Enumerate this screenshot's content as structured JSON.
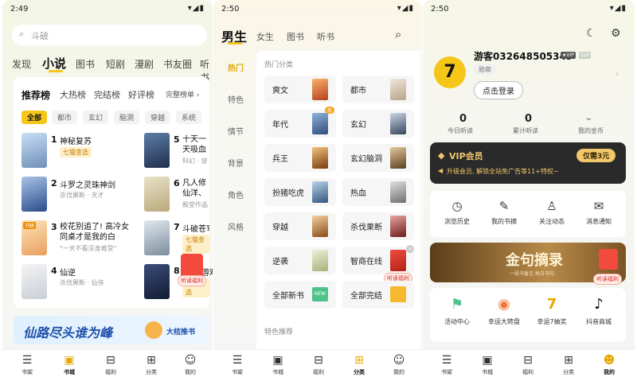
{
  "screen1": {
    "time": "2:49",
    "search_placeholder": "斗破",
    "tabs": [
      "发现",
      "小说",
      "图书",
      "短剧",
      "漫剧",
      "书友圈",
      "听书"
    ],
    "rank_tabs": [
      "推荐榜",
      "大热榜",
      "完结榜",
      "好评榜"
    ],
    "full_list": "完整榜单 ›",
    "chips": [
      "全部",
      "都市",
      "玄幻",
      "脑洞",
      "穿越",
      "系统"
    ],
    "books_left": [
      {
        "rank": "1",
        "title": "神秘复苏",
        "sub": "七猫金选",
        "tag": "badge"
      },
      {
        "rank": "2",
        "title": "斗罗之灵珠神剑",
        "sub": "杀伐果断 · 天才",
        "tag": "text"
      },
      {
        "rank": "3",
        "title": "校花别追了! 高冷女同桌才是我的白",
        "sub": "\"一天不看浑身难受\"",
        "tag": "text"
      },
      {
        "rank": "4",
        "title": "仙逆",
        "sub": "杀伐果断 · 仙侠",
        "tag": "text"
      }
    ],
    "books_right": [
      {
        "rank": "5",
        "title": "十天一天吸血鬼仙",
        "sub": "科幻 · 穿"
      },
      {
        "rank": "6",
        "title": "凡人修仙洋、金属",
        "sub": "殿堂作品"
      },
      {
        "rank": "7",
        "title": "斗破苍穹",
        "sub": "七猫金选"
      },
      {
        "rank": "8",
        "title": "游戏",
        "sub": "七猫金选"
      }
    ],
    "cover_tag": "书耕",
    "banner_text": "仙路尽头谁为峰",
    "banner_btn": "大桔推书",
    "hb_label": "听读福利",
    "nav": [
      "书架",
      "书城",
      "福利",
      "分类",
      "我的"
    ]
  },
  "screen2": {
    "time": "2:50",
    "tabs": [
      "男生",
      "女生",
      "图书",
      "听书"
    ],
    "side": [
      "热门",
      "特色",
      "情节",
      "背景",
      "角色",
      "风格"
    ],
    "section_title": "热门分类",
    "cells": [
      "爽文",
      "都市",
      "年代",
      "玄幻",
      "兵王",
      "玄幻脑洞",
      "扮猪吃虎",
      "热血",
      "穿越",
      "杀伐果断",
      "逆袭",
      "智商在线",
      "全部新书",
      "全部完结"
    ],
    "hot_badge": "热",
    "new_badge": "NEW",
    "section2": "特色推荐",
    "hb_label": "听读福利",
    "nav": [
      "书架",
      "书城",
      "福利",
      "分类",
      "我的"
    ]
  },
  "screen3": {
    "time": "2:50",
    "username": "游客032648505349",
    "vip_tag": "★VIP",
    "lv_tag": "Lv0",
    "medal": "勋章",
    "login_btn": "点击登录",
    "stats": [
      {
        "value": "0",
        "label": "今日听读"
      },
      {
        "value": "0",
        "label": "累计听读"
      },
      {
        "value": "",
        "label": "我的金币"
      }
    ],
    "vip_title": "VIP会员",
    "vip_desc": "升级会员, 解锁全站免广告等11+特权~",
    "vip_price": "仅需3元",
    "menu": [
      "浏览历史",
      "我的书摘",
      "关注动态",
      "消息通知"
    ],
    "banner_text": "金句摘录",
    "banner_sub": "一段书香言,每日书句",
    "activities": [
      "活动中心",
      "幸运大转盘",
      "幸运7抽奖",
      "抖音商城"
    ],
    "hb_label": "听读福利",
    "nav": [
      "书架",
      "书城",
      "福利",
      "分类",
      "我的"
    ]
  },
  "colors": {
    "accent": "#f5c518",
    "vip_gold": "#f0c86a",
    "red": "#f24a3d"
  }
}
